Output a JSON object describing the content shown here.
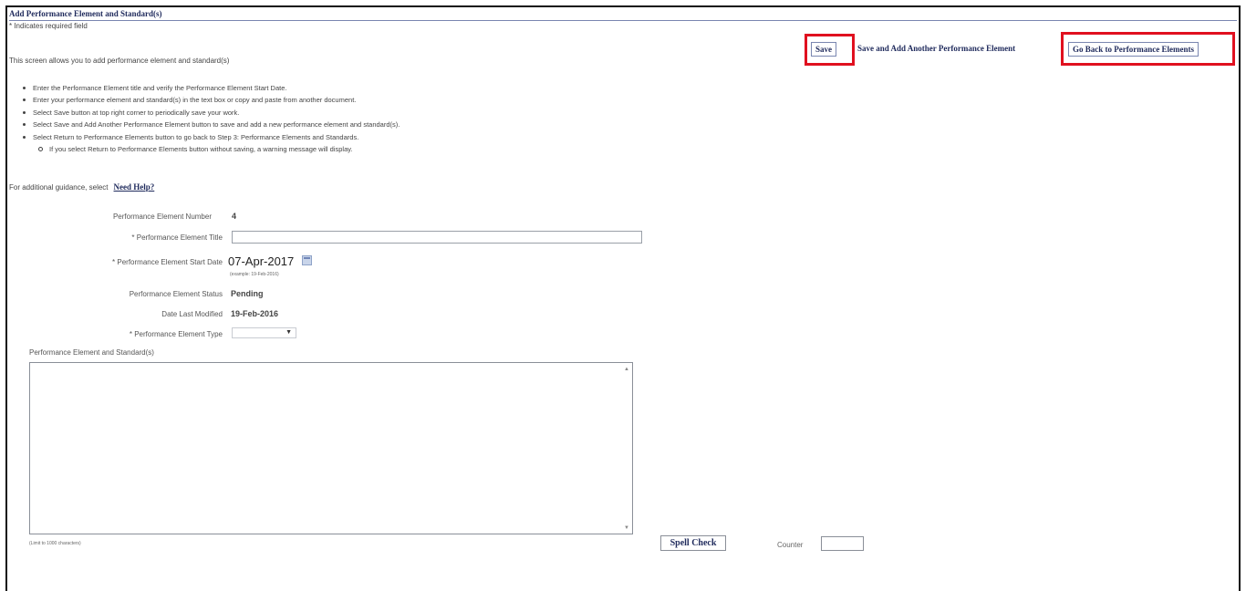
{
  "header": {
    "title": "Add Performance Element and Standard(s)",
    "required_note": "* Indicates required field",
    "intro": "This screen allows you to add performance element and standard(s)"
  },
  "toolbar": {
    "save_label": "Save",
    "save_add_label": "Save and Add Another Performance Element",
    "go_back_label": "Go Back to Performance Elements",
    "highlight_color": "#e0101f"
  },
  "instructions": {
    "items": [
      "Enter the Performance Element title and verify the Performance Element Start Date.",
      "Enter your performance element and standard(s) in the text box or copy and paste from another document.",
      "Select Save button at top right corner to periodically save your work.",
      "Select Save and Add Another Performance Element button to save and add a new performance element and standard(s).",
      "Select Return to Performance Elements button to go back to Step 3: Performance Elements and Standards."
    ],
    "sub_item": "If you select Return to Performance Elements button without saving, a warning message will display."
  },
  "guidance": {
    "text": "For additional guidance, select",
    "link": "Need Help?"
  },
  "form": {
    "number_label": "Performance Element Number",
    "number_value": "4",
    "title_label": "* Performance Element Title",
    "title_value": "",
    "start_date_label": "* Performance Element Start Date",
    "start_date_value": "07-Apr-2017",
    "start_date_example": "(example: 19-Feb-2016)",
    "status_label": "Performance Element Status",
    "status_value": "Pending",
    "modified_label": "Date Last Modified",
    "modified_value": "19-Feb-2016",
    "type_label": "* Performance Element Type",
    "type_value": "",
    "standards_label": "Performance Element and Standard(s)",
    "standards_value": "",
    "limit_note": "(Limit to 1000 characters)",
    "spell_check_label": "Spell Check",
    "counter_label": "Counter",
    "counter_value": ""
  }
}
